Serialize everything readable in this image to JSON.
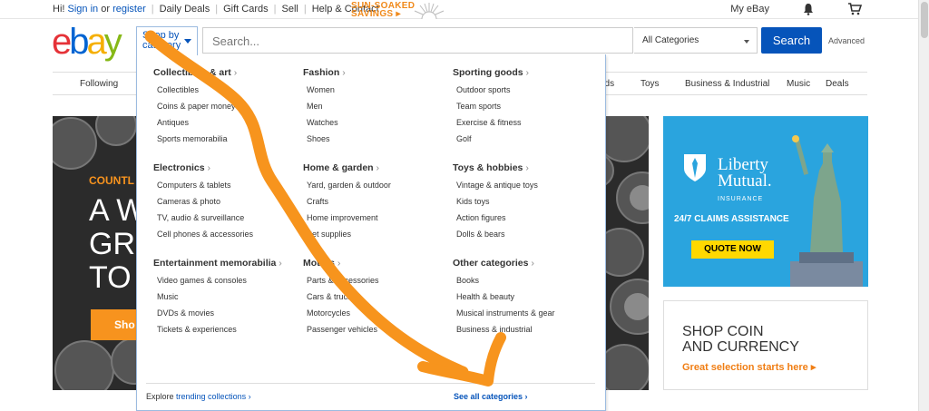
{
  "topbar": {
    "greeting": "Hi!",
    "sign_in": "Sign in",
    "or": "or",
    "register": "register",
    "links": [
      "Daily Deals",
      "Gift Cards",
      "Sell",
      "Help & Contact"
    ],
    "promo_line1": "SUN-SOAKED",
    "promo_line2": "SAVINGS ▸",
    "my_ebay": "My eBay",
    "bell_icon": "bell-icon",
    "cart_icon": "cart-icon"
  },
  "header": {
    "logo": {
      "e": "e",
      "b": "b",
      "a": "a",
      "y": "y"
    },
    "shop_by": "Shop by category",
    "search_placeholder": "Search...",
    "category_select": "All Categories",
    "search_button": "Search",
    "advanced": "Advanced"
  },
  "catnav": {
    "items": [
      "Following",
      "ods",
      "Toys",
      "Business & Industrial",
      "Music",
      "Deals"
    ]
  },
  "flyout": {
    "columns": [
      {
        "groups": [
          {
            "title": "Collectibles & art",
            "items": [
              "Collectibles",
              "Coins & paper money",
              "Antiques",
              "Sports memorabilia"
            ]
          },
          {
            "title": "Electronics",
            "items": [
              "Computers & tablets",
              "Cameras & photo",
              "TV, audio & surveillance",
              "Cell phones & accessories"
            ]
          },
          {
            "title": "Entertainment memorabilia",
            "items": [
              "Video games & consoles",
              "Music",
              "DVDs & movies",
              "Tickets & experiences"
            ]
          }
        ]
      },
      {
        "groups": [
          {
            "title": "Fashion",
            "items": [
              "Women",
              "Men",
              "Watches",
              "Shoes"
            ]
          },
          {
            "title": "Home & garden",
            "items": [
              "Yard, garden & outdoor",
              "Crafts",
              "Home improvement",
              "Pet supplies"
            ]
          },
          {
            "title": "Motors",
            "items": [
              "Parts & accessories",
              "Cars & trucks",
              "Motorcycles",
              "Passenger vehicles"
            ]
          }
        ]
      },
      {
        "groups": [
          {
            "title": "Sporting goods",
            "items": [
              "Outdoor sports",
              "Team sports",
              "Exercise & fitness",
              "Golf"
            ]
          },
          {
            "title": "Toys & hobbies",
            "items": [
              "Vintage & antique toys",
              "Kids toys",
              "Action figures",
              "Dolls & bears"
            ]
          },
          {
            "title": "Other categories",
            "items": [
              "Books",
              "Health & beauty",
              "Musical instruments & gear",
              "Business & industrial"
            ]
          }
        ]
      }
    ],
    "explore_prefix": "Explore",
    "explore_link": "trending collections ›",
    "see_all": "See all categories ›"
  },
  "hero": {
    "label": "COUNTL",
    "big_lines": [
      "A W",
      "GR",
      "TO"
    ],
    "shop_button": "Sho"
  },
  "ads": {
    "liberty_line1": "Liberty",
    "liberty_line2": "Mutual.",
    "liberty_insurance": "INSURANCE",
    "claims": "24/7 CLAIMS ASSISTANCE",
    "quote": "QUOTE NOW",
    "coin_heading_1": "SHOP COIN",
    "coin_heading_2": "AND CURRENCY",
    "coin_sub": "Great selection starts here ▸"
  },
  "colors": {
    "ebay_blue": "#0654ba",
    "annotation_orange": "#f7941d",
    "liberty_bg": "#2aa4de"
  }
}
